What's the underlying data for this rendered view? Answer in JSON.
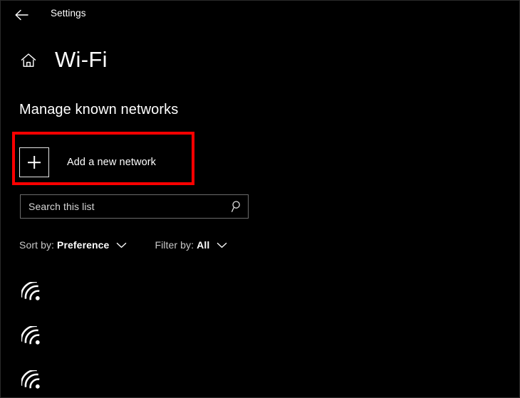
{
  "window": {
    "titlebar": {
      "back_icon": "arrow-left-icon",
      "app_name": "Settings"
    }
  },
  "page": {
    "home_icon": "home-icon",
    "title": "Wi-Fi"
  },
  "section": {
    "heading": "Manage known networks"
  },
  "add_network": {
    "icon": "plus-icon",
    "label": "Add a new network",
    "highlight_color": "#ff0000",
    "highlighted": true
  },
  "search": {
    "value": "",
    "placeholder": "Search this list",
    "icon": "search-icon"
  },
  "filters": [
    {
      "label": "Sort by:",
      "value": "Preference",
      "chevron_icon": "chevron-down-icon"
    },
    {
      "label": "Filter by:",
      "value": "All",
      "chevron_icon": "chevron-down-icon"
    }
  ],
  "networks": [
    {
      "icon": "wifi-icon",
      "name": ""
    },
    {
      "icon": "wifi-icon",
      "name": ""
    },
    {
      "icon": "wifi-icon",
      "name": ""
    }
  ],
  "theme": {
    "background": "#000000",
    "foreground": "#ffffff",
    "muted": "#c9c9c9",
    "border": "#6b6b6b",
    "accent": "#ff0000"
  }
}
